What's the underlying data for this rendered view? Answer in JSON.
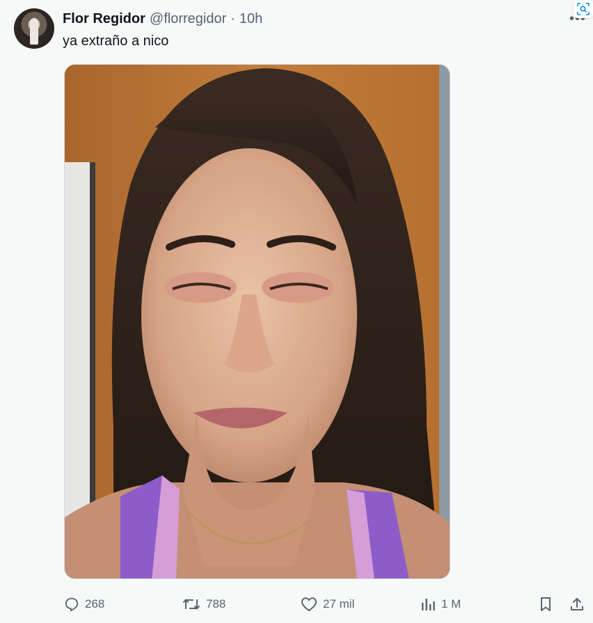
{
  "tweet": {
    "display_name": "Flor Regidor",
    "handle": "@florregidor",
    "separator": "·",
    "time": "10h",
    "text": "ya extraño a nico",
    "more_icon": "more-dots-icon"
  },
  "actions": {
    "replies": "268",
    "retweets": "788",
    "likes": "27 mil",
    "views": "1 M"
  },
  "colors": {
    "text_primary": "#0f1419",
    "text_secondary": "#536471",
    "background": "#f7f9f9",
    "accent": "#1d9bf0"
  }
}
